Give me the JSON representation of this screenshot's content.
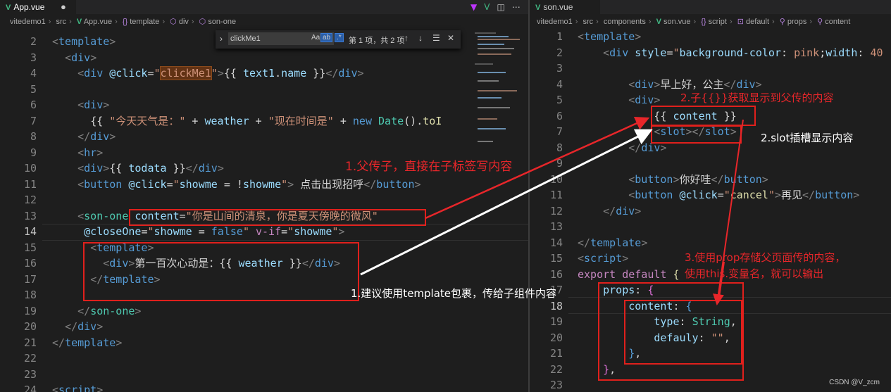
{
  "left_tab": {
    "label": "App.vue",
    "modified_dot": "●"
  },
  "left_tab_icons": [
    "vite-icon",
    "vue-icon",
    "split-icon",
    "more-icon"
  ],
  "left_breadcrumb": {
    "parts": [
      "vitedemo1",
      "src",
      "App.vue",
      "template",
      "div",
      "son-one"
    ]
  },
  "find_widget": {
    "query": "clickMe1",
    "opt_case": "Aa",
    "opt_word": "ab",
    "opt_regex": ".*",
    "result": "第 1 项，共 2 项",
    "prev": "↑",
    "next": "↓",
    "selection": "☰",
    "close": "✕"
  },
  "left_lines": [
    {
      "n": "2",
      "html": "<span class='tg'>&lt;</span><span class='tn'>template</span><span class='tg'>&gt;</span>"
    },
    {
      "n": "3",
      "html": "  <span class='tg'>&lt;</span><span class='tn'>div</span><span class='tg'>&gt;</span>"
    },
    {
      "n": "4",
      "html": "    <span class='tg'>&lt;</span><span class='tn'>div</span> <span class='at'>@click</span><span class='tx'>=</span><span class='st'>\"<span class='hl'>clickMe1</span>\"</span><span class='tg'>&gt;</span><span class='tx'>{{ </span><span class='at'>text1</span><span class='tx'>.</span><span class='at'>name</span><span class='tx'> }}</span><span class='tg'>&lt;/</span><span class='tn'>div</span><span class='tg'>&gt;</span>"
    },
    {
      "n": "5",
      "html": ""
    },
    {
      "n": "6",
      "html": "    <span class='tg'>&lt;</span><span class='tn'>div</span><span class='tg'>&gt;</span>"
    },
    {
      "n": "7",
      "html": "      <span class='tx'>{{ </span><span class='st'>\"今天天气是：\"</span><span class='tx'> + </span><span class='at'>weather</span><span class='tx'> + </span><span class='st'>\"现在时间是\"</span><span class='tx'> + </span><span class='tn'>new</span> <span class='ty'>Date</span><span class='tx'>().</span><span class='fn'>toI</span>"
    },
    {
      "n": "8",
      "html": "    <span class='tg'>&lt;/</span><span class='tn'>div</span><span class='tg'>&gt;</span>"
    },
    {
      "n": "9",
      "html": "    <span class='tg'>&lt;</span><span class='tn'>hr</span><span class='tg'>&gt;</span>"
    },
    {
      "n": "10",
      "html": "    <span class='tg'>&lt;</span><span class='tn'>div</span><span class='tg'>&gt;</span><span class='tx'>{{ </span><span class='at'>todata</span><span class='tx'> }}</span><span class='tg'>&lt;/</span><span class='tn'>div</span><span class='tg'>&gt;</span>"
    },
    {
      "n": "11",
      "html": "    <span class='tg'>&lt;</span><span class='tn'>button</span> <span class='at'>@click</span><span class='tx'>=</span><span class='st'>\"</span><span class='at'>showme</span><span class='tx'> = !</span><span class='at'>showme</span><span class='st'>\"</span><span class='tg'>&gt;</span><span class='tx'> 点击出现招呼</span><span class='tg'>&lt;/</span><span class='tn'>button</span><span class='tg'>&gt;</span>"
    },
    {
      "n": "12",
      "html": ""
    },
    {
      "n": "13",
      "html": "    <span class='tg'>&lt;</span><span class='ty'>son-one</span> <span class='at'>content</span><span class='tx'>=</span><span class='st'>\"你是山间的清泉，你是夏天傍晚的微风\"</span>"
    },
    {
      "n": "14",
      "html": "     <span class='at'>@closeOne</span><span class='tx'>=</span><span class='st'>\"</span><span class='at'>showme</span><span class='tx'> = </span><span class='tn'>false</span><span class='st'>\"</span> <span class='kw'>v-if</span><span class='tx'>=</span><span class='st'>\"</span><span class='at'>showme</span><span class='st'>\"</span><span class='tg'>&gt;</span>"
    },
    {
      "n": "15",
      "html": "      <span class='tg'>&lt;</span><span class='tn'>template</span><span class='tg'>&gt;</span>"
    },
    {
      "n": "16",
      "html": "        <span class='tg'>&lt;</span><span class='tn'>div</span><span class='tg'>&gt;</span><span class='tx'>第一百次心动是：{{ </span><span class='at'>weather</span><span class='tx'> }}</span><span class='tg'>&lt;/</span><span class='tn'>div</span><span class='tg'>&gt;</span>"
    },
    {
      "n": "17",
      "html": "      <span class='tg'>&lt;/</span><span class='tn'>template</span><span class='tg'>&gt;</span>"
    },
    {
      "n": "18",
      "html": ""
    },
    {
      "n": "19",
      "html": "    <span class='tg'>&lt;/</span><span class='ty'>son-one</span><span class='tg'>&gt;</span>"
    },
    {
      "n": "20",
      "html": "  <span class='tg'>&lt;/</span><span class='tn'>div</span><span class='tg'>&gt;</span>"
    },
    {
      "n": "21",
      "html": "<span class='tg'>&lt;/</span><span class='tn'>template</span><span class='tg'>&gt;</span>"
    },
    {
      "n": "22",
      "html": ""
    },
    {
      "n": "23",
      "html": ""
    },
    {
      "n": "24",
      "html": "<span class='tg'>&lt;</span><span class='tn'>script</span><span class='tg'>&gt;</span>"
    }
  ],
  "right_tab": {
    "label": "son.vue"
  },
  "right_breadcrumb": {
    "parts": [
      "vitedemo1",
      "src",
      "components",
      "son.vue",
      "script",
      "default",
      "props",
      "content"
    ]
  },
  "right_lines": [
    {
      "n": "1",
      "html": "<span class='tg'>&lt;</span><span class='tn'>template</span><span class='tg'>&gt;</span>"
    },
    {
      "n": "2",
      "html": "    <span class='tg'>&lt;</span><span class='tn'>div</span> <span class='at'>style</span><span class='tx'>=</span><span class='st'>\"</span><span class='at'>background-color</span><span class='tx'>: </span><span class='st'>pink</span><span class='tx'>;</span><span class='at'>width</span><span class='tx'>: </span><span class='st'>40</span>"
    },
    {
      "n": "3",
      "html": ""
    },
    {
      "n": "4",
      "html": "        <span class='tg'>&lt;</span><span class='tn'>div</span><span class='tg'>&gt;</span><span class='tx'>早上好，公主</span><span class='tg'>&lt;/</span><span class='tn'>div</span><span class='tg'>&gt;</span>"
    },
    {
      "n": "5",
      "html": "        <span class='tg'>&lt;</span><span class='tn'>div</span><span class='tg'>&gt;</span>"
    },
    {
      "n": "6",
      "html": "            <span class='tx'>{{ </span><span class='at'>content</span><span class='tx'> }}</span>"
    },
    {
      "n": "7",
      "html": "            <span class='tg'>&lt;</span><span class='tn'>slot</span><span class='tg'>&gt;&lt;/</span><span class='tn'>slot</span><span class='tg'>&gt;</span>"
    },
    {
      "n": "8",
      "html": "        <span class='tg'>&lt;/</span><span class='tn'>div</span><span class='tg'>&gt;</span>"
    },
    {
      "n": "9",
      "html": ""
    },
    {
      "n": "10",
      "html": "        <span class='tg'>&lt;</span><span class='tn'>button</span><span class='tg'>&gt;</span><span class='tx'>你好哇</span><span class='tg'>&lt;/</span><span class='tn'>button</span><span class='tg'>&gt;</span>"
    },
    {
      "n": "11",
      "html": "        <span class='tg'>&lt;</span><span class='tn'>button</span> <span class='at'>@click</span><span class='tx'>=</span><span class='st'>\"</span><span class='fn'>cancel</span><span class='st'>\"</span><span class='tg'>&gt;</span><span class='tx'>再见</span><span class='tg'>&lt;/</span><span class='tn'>button</span><span class='tg'>&gt;</span>"
    },
    {
      "n": "12",
      "html": "    <span class='tg'>&lt;/</span><span class='tn'>div</span><span class='tg'>&gt;</span>"
    },
    {
      "n": "13",
      "html": ""
    },
    {
      "n": "14",
      "html": "<span class='tg'>&lt;/</span><span class='tn'>template</span><span class='tg'>&gt;</span>"
    },
    {
      "n": "15",
      "html": "<span class='tg'>&lt;</span><span class='tn'>script</span><span class='tg'>&gt;</span>"
    },
    {
      "n": "16",
      "html": "<span class='kw'>export</span> <span class='kw'>default</span> <span class='fn'>{</span>"
    },
    {
      "n": "17",
      "html": "    <span class='at'>props</span><span class='tx'>: </span><span class='br'>{</span>"
    },
    {
      "n": "18",
      "html": "        <span class='at'>content</span><span class='tx'>: </span><span class='tn'>{</span>"
    },
    {
      "n": "19",
      "html": "            <span class='at'>type</span><span class='tx'>: </span><span class='ty'>String</span><span class='tx'>,</span>"
    },
    {
      "n": "20",
      "html": "            <span class='at'>defauly</span><span class='tx'>: </span><span class='st'>\"\"</span><span class='tx'>,</span>"
    },
    {
      "n": "21",
      "html": "        <span class='tn'>}</span><span class='tx'>,</span>"
    },
    {
      "n": "22",
      "html": "    <span class='br'>}</span><span class='tx'>,</span>"
    },
    {
      "n": "23",
      "html": ""
    }
  ],
  "annotations": {
    "a1": "1.父传子，直接在子标签写内容",
    "a1b": "1.建议使用template包裹，传给子组件内容",
    "a2": "2.子{{}}获取显示到父传的内容",
    "a2b": "2.slot插槽显示内容",
    "a3_line1": "3.使用prop存储父页面传的内容，",
    "a3_line2": "使用this.变量名，就可以输出"
  },
  "watermark": "CSDN @V_zcm",
  "colors": {
    "annotation_red": "#e8262a",
    "editor_bg": "#1e1e1e",
    "vue_green": "#41b883"
  }
}
